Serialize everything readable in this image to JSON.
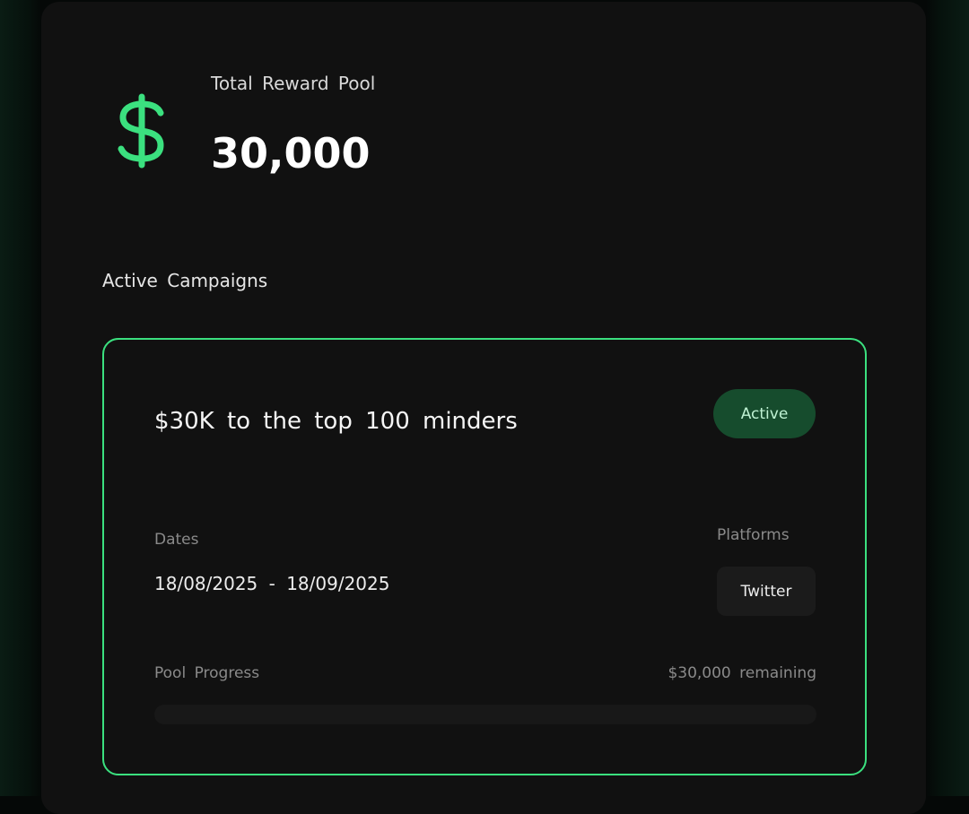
{
  "reward_pool": {
    "icon": "dollar-icon",
    "label": "Total Reward Pool",
    "value": "30,000"
  },
  "section": {
    "title": "Active Campaigns"
  },
  "campaign": {
    "title": "$30K to the top 100 minders",
    "status": "Active",
    "dates_label": "Dates",
    "dates_value": "18/08/2025 - 18/09/2025",
    "platforms_label": "Platforms",
    "platforms": [
      "Twitter"
    ],
    "pool_progress_label": "Pool Progress",
    "remaining_text": "$30,000 remaining",
    "progress_fraction": 0
  },
  "colors": {
    "accent": "#3be07f",
    "badge_bg": "#164c2d",
    "panel_bg": "#111111",
    "page_bg": "#050807"
  }
}
